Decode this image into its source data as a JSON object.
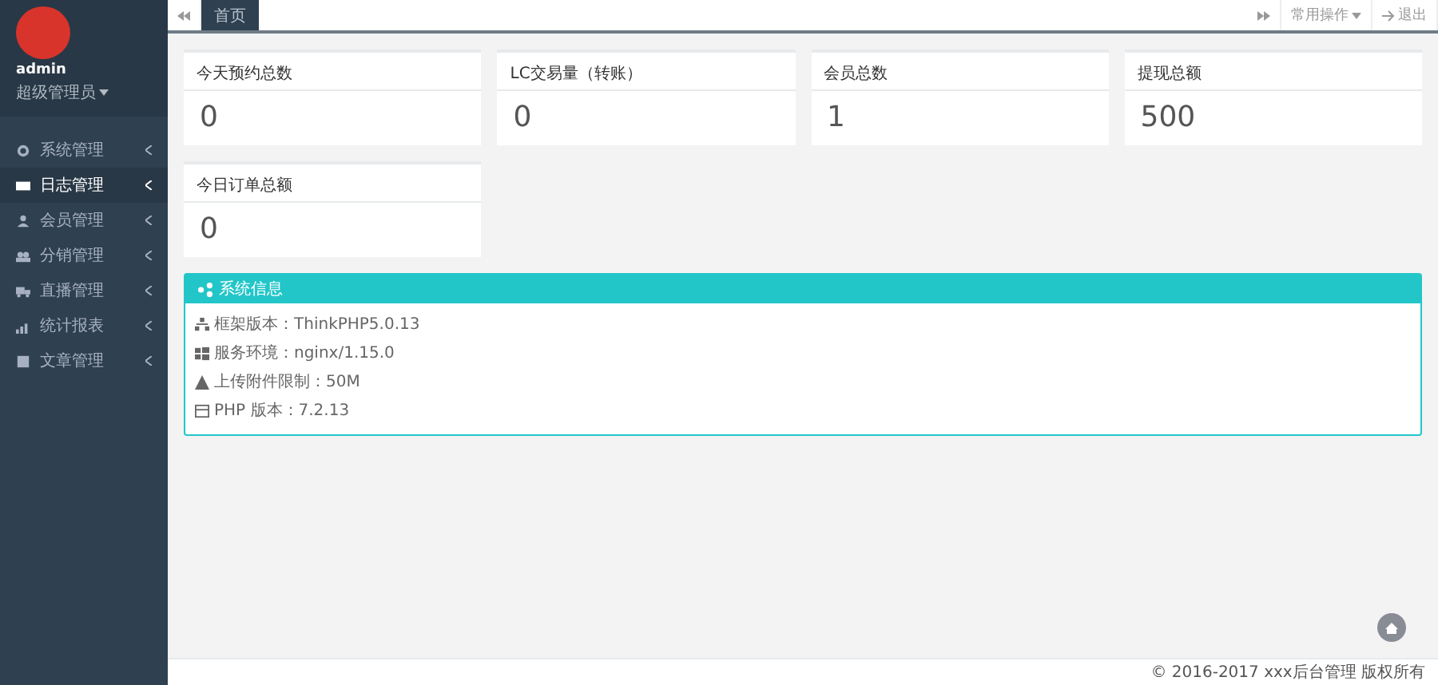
{
  "user": {
    "name": "admin",
    "role": "超级管理员"
  },
  "sidebar": {
    "items": [
      {
        "label": "系统管理",
        "selected": false
      },
      {
        "label": "日志管理",
        "selected": true
      },
      {
        "label": "会员管理",
        "selected": false
      },
      {
        "label": "分销管理",
        "selected": false
      },
      {
        "label": "直播管理",
        "selected": false
      },
      {
        "label": "统计报表",
        "selected": false
      },
      {
        "label": "文章管理",
        "selected": false
      }
    ]
  },
  "tabs": [
    {
      "label": "首页",
      "selected": true
    }
  ],
  "toolbar": {
    "menu": "常用操作",
    "logout": "退出"
  },
  "stats": [
    {
      "title": "今天预约总数",
      "value": "0"
    },
    {
      "title": "LC交易量（转账）",
      "value": "0"
    },
    {
      "title": "会员总数",
      "value": "1"
    },
    {
      "title": "提现总额",
      "value": "500"
    },
    {
      "title": "今日订单总额",
      "value": "0"
    }
  ],
  "info_panel": {
    "title": "系统信息",
    "lines": [
      "框架版本：ThinkPHP5.0.13",
      "服务环境：nginx/1.15.0",
      "上传附件限制：50M",
      "PHP 版本：7.2.13"
    ]
  },
  "footer": "© 2016-2017 xxx后台管理 版权所有"
}
